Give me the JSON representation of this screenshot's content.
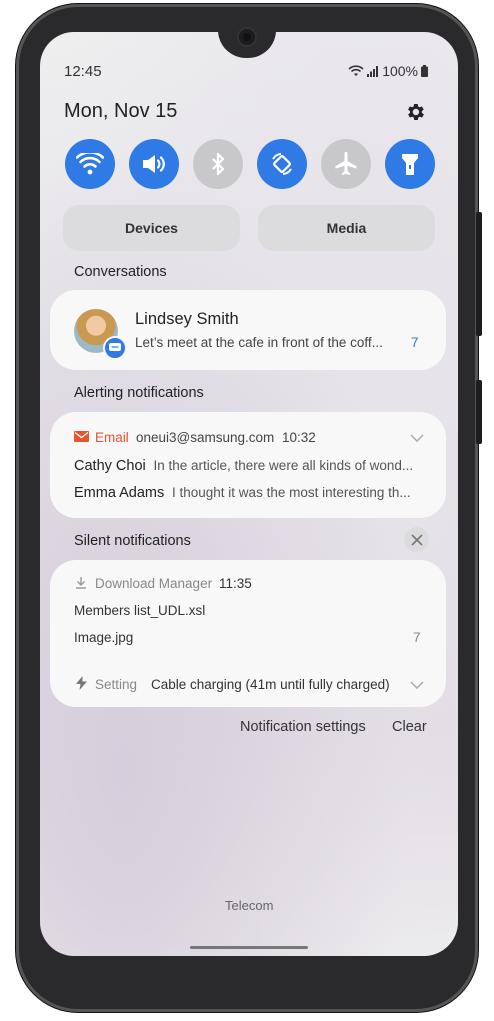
{
  "status": {
    "time": "12:45",
    "battery": "100%"
  },
  "panel": {
    "date": "Mon, Nov 15"
  },
  "quick_settings": [
    {
      "name": "wifi-icon",
      "state": "on"
    },
    {
      "name": "sound-icon",
      "state": "on"
    },
    {
      "name": "bluetooth-icon",
      "state": "off"
    },
    {
      "name": "auto-rotate-icon",
      "state": "on"
    },
    {
      "name": "airplane-icon",
      "state": "off"
    },
    {
      "name": "flashlight-icon",
      "state": "on"
    }
  ],
  "buttons": {
    "devices": "Devices",
    "media": "Media"
  },
  "sections": {
    "conversations": "Conversations",
    "alerting": "Alerting notifications",
    "silent": "Silent notifications"
  },
  "conversation": {
    "name": "Lindsey Smith",
    "message": "Let’s meet at the cafe in front of the coff...",
    "count": "7"
  },
  "email": {
    "app": "Email",
    "account": "oneui3@samsung.com",
    "time": "10:32",
    "items": [
      {
        "sender": "Cathy Choi",
        "preview": "In the article, there were all kinds of wond..."
      },
      {
        "sender": "Emma Adams",
        "preview": "I thought it was the most interesting th..."
      }
    ]
  },
  "download": {
    "app": "Download Manager",
    "time": "11:35",
    "file1": "Members list_UDL.xsl",
    "file2": "Image.jpg",
    "count": "7"
  },
  "setting": {
    "app": "Setting",
    "text": "Cable charging (41m until fully charged)"
  },
  "footer": {
    "notification_settings": "Notification settings",
    "clear": "Clear"
  },
  "carrier": "Telecom",
  "colors": {
    "accent": "#2f7ae5",
    "email": "#e8542e",
    "toggle_off": "#c8c8cb"
  }
}
